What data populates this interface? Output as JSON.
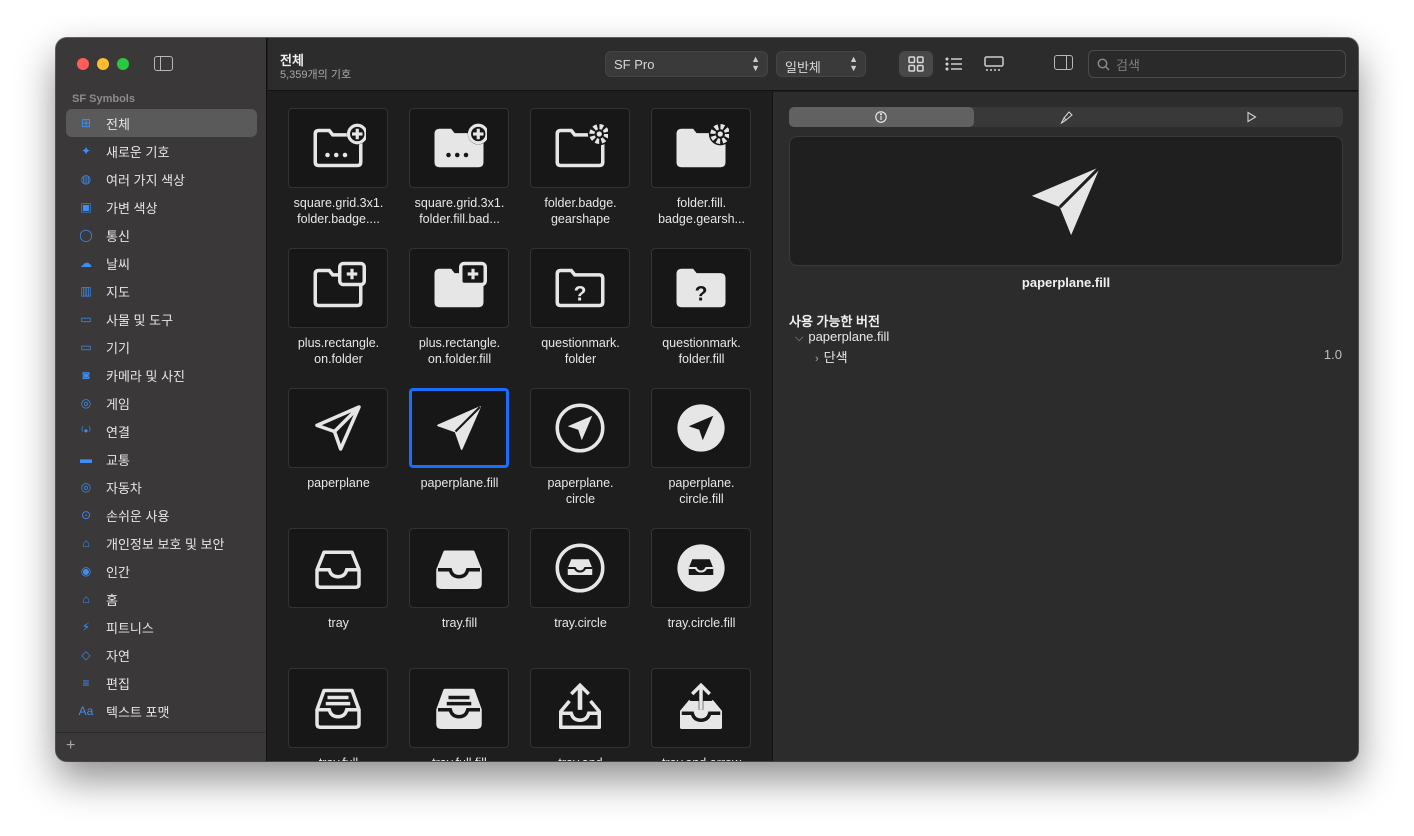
{
  "sidebar": {
    "section_title": "SF Symbols",
    "items": [
      {
        "label": "전체",
        "icon": "grid-icon",
        "glyph": "⊞"
      },
      {
        "label": "새로운 기호",
        "icon": "sparkles-icon",
        "glyph": "✦"
      },
      {
        "label": "여러 가지 색상",
        "icon": "paintpalette-icon",
        "glyph": "◍"
      },
      {
        "label": "가변 색상",
        "icon": "variable-color-icon",
        "glyph": "▣"
      },
      {
        "label": "통신",
        "icon": "message-icon",
        "glyph": "◯"
      },
      {
        "label": "날씨",
        "icon": "cloud-sun-icon",
        "glyph": "☁"
      },
      {
        "label": "지도",
        "icon": "map-icon",
        "glyph": "▥"
      },
      {
        "label": "사물 및 도구",
        "icon": "folder-icon",
        "glyph": "▭"
      },
      {
        "label": "기기",
        "icon": "display-icon",
        "glyph": "▭"
      },
      {
        "label": "카메라 및 사진",
        "icon": "camera-icon",
        "glyph": "◙"
      },
      {
        "label": "게임",
        "icon": "gamecontroller-icon",
        "glyph": "◎"
      },
      {
        "label": "연결",
        "icon": "antenna-icon",
        "glyph": "⁽•⁾"
      },
      {
        "label": "교통",
        "icon": "car-icon",
        "glyph": "▬"
      },
      {
        "label": "자동차",
        "icon": "steering-wheel-icon",
        "glyph": "◎"
      },
      {
        "label": "손쉬운 사용",
        "icon": "accessibility-icon",
        "glyph": "⊙"
      },
      {
        "label": "개인정보 보호 및 보안",
        "icon": "lock-icon",
        "glyph": "⌂"
      },
      {
        "label": "인간",
        "icon": "person-circle-icon",
        "glyph": "◉"
      },
      {
        "label": "홈",
        "icon": "house-icon",
        "glyph": "⌂"
      },
      {
        "label": "피트니스",
        "icon": "figure-run-icon",
        "glyph": "⚡"
      },
      {
        "label": "자연",
        "icon": "leaf-icon",
        "glyph": "◇"
      },
      {
        "label": "편집",
        "icon": "sliders-icon",
        "glyph": "≡"
      },
      {
        "label": "텍스트 포맷",
        "icon": "textformat-icon",
        "glyph": "Aa"
      },
      {
        "label": "",
        "icon": "more-icon",
        "glyph": ""
      }
    ]
  },
  "toolbar": {
    "title": "전체",
    "subtitle": "5,359개의 기호",
    "font_select": "SF Pro",
    "weight_select": "일반체",
    "search_placeholder": "검색"
  },
  "grid": {
    "symbols": [
      {
        "caption": "square.grid.3x1.\nfolder.badge....",
        "icon": "folder-badge-plus-outline-icon"
      },
      {
        "caption": "square.grid.3x1.\nfolder.fill.bad...",
        "icon": "folder-badge-plus-fill-icon"
      },
      {
        "caption": "folder.badge.\ngearshape",
        "icon": "folder-badge-gear-outline-icon"
      },
      {
        "caption": "folder.fill.\nbadge.gearsh...",
        "icon": "folder-badge-gear-fill-icon"
      },
      {
        "caption": "plus.rectangle.\non.folder",
        "icon": "plus-rectangle-folder-outline-icon"
      },
      {
        "caption": "plus.rectangle.\non.folder.fill",
        "icon": "plus-rectangle-folder-fill-icon"
      },
      {
        "caption": "questionmark.\nfolder",
        "icon": "questionmark-folder-outline-icon"
      },
      {
        "caption": "questionmark.\nfolder.fill",
        "icon": "questionmark-folder-fill-icon"
      },
      {
        "caption": "paperplane",
        "icon": "paperplane-outline-icon"
      },
      {
        "caption": "paperplane.fill",
        "icon": "paperplane-fill-icon",
        "selected": true
      },
      {
        "caption": "paperplane.\ncircle",
        "icon": "paperplane-circle-icon"
      },
      {
        "caption": "paperplane.\ncircle.fill",
        "icon": "paperplane-circle-fill-icon"
      },
      {
        "caption": "tray",
        "icon": "tray-outline-icon"
      },
      {
        "caption": "tray.fill",
        "icon": "tray-fill-icon"
      },
      {
        "caption": "tray.circle",
        "icon": "tray-circle-icon"
      },
      {
        "caption": "tray.circle.fill",
        "icon": "tray-circle-fill-icon"
      },
      {
        "caption": "tray.full",
        "icon": "tray-full-outline-icon"
      },
      {
        "caption": "tray.full.fill",
        "icon": "tray-full-fill-icon"
      },
      {
        "caption": "tray.and",
        "icon": "tray-and-arrow-up-outline-icon"
      },
      {
        "caption": "tray.and.arrow",
        "icon": "tray-and-arrow-up-fill-icon"
      }
    ]
  },
  "detail": {
    "symbol_name": "paperplane.fill",
    "versions_title": "사용 가능한 버전",
    "version_symbol": "paperplane.fill",
    "version_mode": "단색",
    "version_number": "1.0"
  }
}
